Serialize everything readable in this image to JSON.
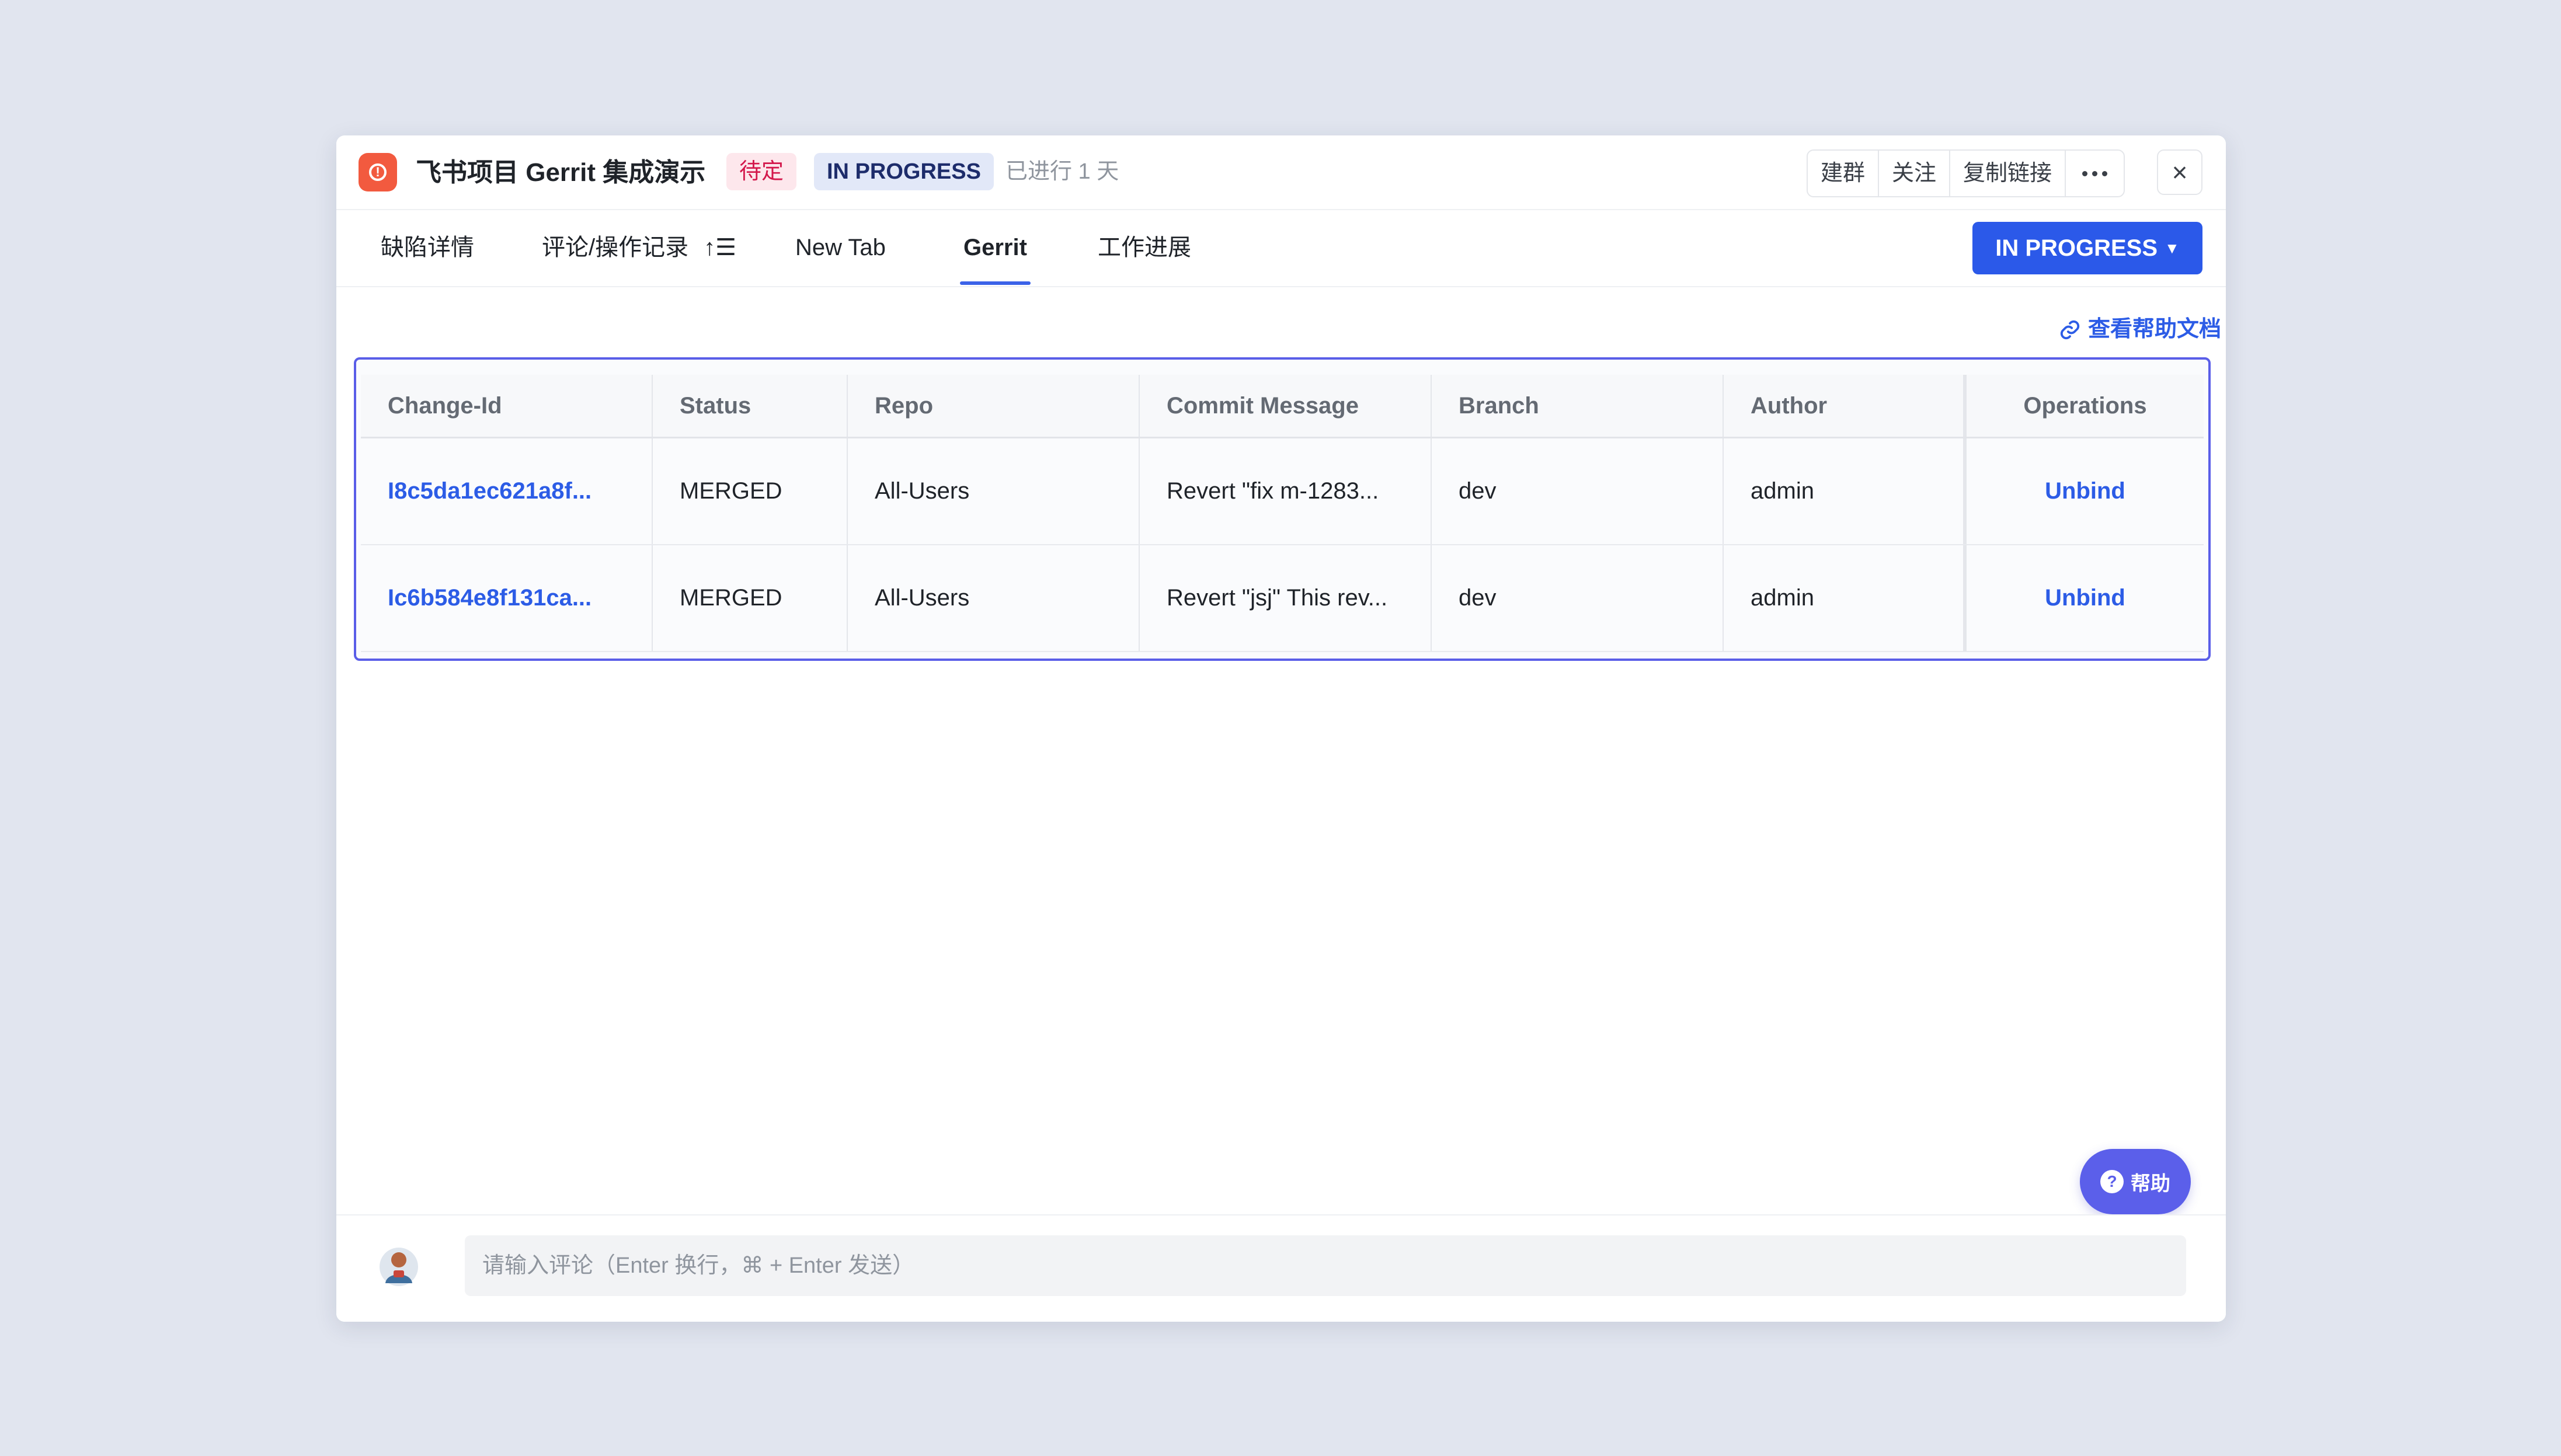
{
  "header": {
    "title": "飞书项目 Gerrit 集成演示",
    "badge_pending": "待定",
    "badge_status": "IN PROGRESS",
    "elapsed": "已进行 1 天",
    "actions": [
      "建群",
      "关注",
      "复制链接"
    ],
    "close": "×",
    "type_icon": "alert-circle-icon",
    "type_icon_color": "#f25a3f"
  },
  "tabs": [
    {
      "label": "缺陷详情",
      "active": false
    },
    {
      "label": "评论/操作记录",
      "active": false
    },
    {
      "label": "New Tab",
      "active": false
    },
    {
      "label": "Gerrit",
      "active": true
    },
    {
      "label": "工作进展",
      "active": false
    }
  ],
  "status_button": {
    "label": "IN PROGRESS",
    "color": "#2b59e9"
  },
  "help_doc": {
    "label": "查看帮助文档"
  },
  "table": {
    "columns": [
      "Change-Id",
      "Status",
      "Repo",
      "Commit Message",
      "Branch",
      "Author",
      "Operations"
    ],
    "rows": [
      [
        "I8c5da1ec621a8f...",
        "MERGED",
        "All-Users",
        "Revert \"fix m-1283...",
        "dev",
        "admin",
        "Unbind"
      ],
      [
        "Ic6b584e8f131ca...",
        "MERGED",
        "All-Users",
        "Revert \"jsj\" This rev...",
        "dev",
        "admin",
        "Unbind"
      ]
    ]
  },
  "help_fab": {
    "label": "帮助"
  },
  "comment": {
    "placeholder": "请输入评论（Enter 换行，⌘ + Enter 发送）",
    "value": ""
  },
  "colors": {
    "accent": "#2c5ce6",
    "selection_border": "#5a5ee8",
    "pending_text": "#d3174b"
  }
}
